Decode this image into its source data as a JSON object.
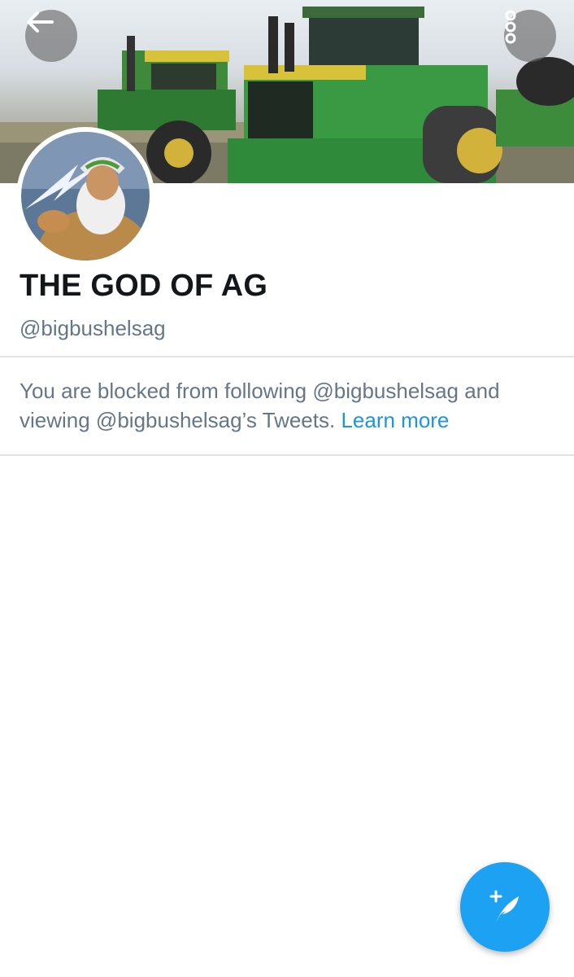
{
  "header": {
    "banner_description": "banner-image",
    "back_icon": "arrow-left-icon",
    "more_icon": "more-vertical-icon"
  },
  "profile": {
    "display_name": "THE GOD OF AG",
    "handle": "@bigbushelsag",
    "avatar_icon": "avatar-image"
  },
  "notice": {
    "text": "You are blocked from following @bigbushelsag and viewing @bigbushelsag’s Tweets. ",
    "link": "Learn more"
  },
  "fab": {
    "icon": "compose-tweet-icon"
  },
  "colors": {
    "accent": "#1da1f2",
    "link": "#1b95e0",
    "secondary_text": "#657786",
    "primary_text": "#14171a",
    "divider": "#dfe3e6"
  }
}
